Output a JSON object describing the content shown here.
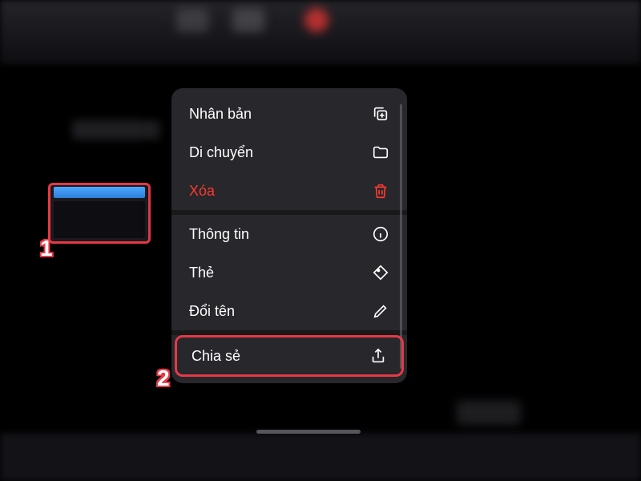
{
  "callouts": {
    "one": "1",
    "two": "2"
  },
  "menu": {
    "duplicate": "Nhân bản",
    "move": "Di chuyển",
    "delete": "Xóa",
    "info": "Thông tin",
    "tag": "Thẻ",
    "rename": "Đổi tên",
    "share": "Chia sẻ"
  },
  "colors": {
    "destructive": "#ff3a30",
    "highlight": "#e63946",
    "menu_bg": "rgba(40,40,45,0.97)"
  }
}
